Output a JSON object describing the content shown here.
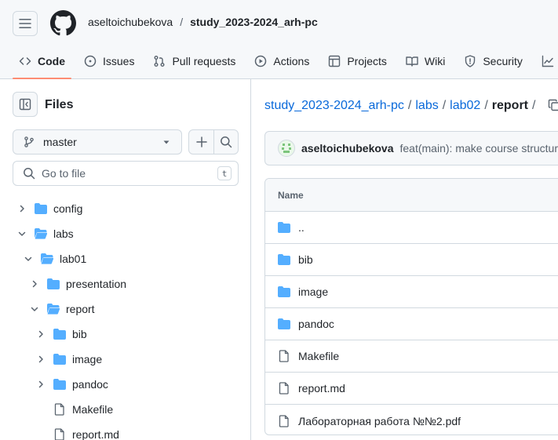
{
  "header": {
    "owner": "aseltoichubekova",
    "separator": "/",
    "repo": "study_2023-2024_arh-pc"
  },
  "tabs": [
    {
      "label": "Code",
      "icon": "code-icon",
      "active": true
    },
    {
      "label": "Issues",
      "icon": "issue-icon",
      "active": false
    },
    {
      "label": "Pull requests",
      "icon": "pull-request-icon",
      "active": false
    },
    {
      "label": "Actions",
      "icon": "play-icon",
      "active": false
    },
    {
      "label": "Projects",
      "icon": "table-icon",
      "active": false
    },
    {
      "label": "Wiki",
      "icon": "book-icon",
      "active": false
    },
    {
      "label": "Security",
      "icon": "shield-icon",
      "active": false
    },
    {
      "label": "",
      "icon": "graph-icon",
      "active": false
    }
  ],
  "sidebar": {
    "title": "Files",
    "branch": "master",
    "goto_placeholder": "Go to file",
    "goto_shortcut": "t",
    "tree": [
      {
        "name": "config",
        "type": "dir",
        "depth": 0,
        "expanded": false
      },
      {
        "name": "labs",
        "type": "dir",
        "depth": 0,
        "expanded": true
      },
      {
        "name": "lab01",
        "type": "dir",
        "depth": 1,
        "expanded": true
      },
      {
        "name": "presentation",
        "type": "dir",
        "depth": 2,
        "expanded": false
      },
      {
        "name": "report",
        "type": "dir",
        "depth": 2,
        "expanded": true
      },
      {
        "name": "bib",
        "type": "dir",
        "depth": 3,
        "expanded": false
      },
      {
        "name": "image",
        "type": "dir",
        "depth": 3,
        "expanded": false
      },
      {
        "name": "pandoc",
        "type": "dir",
        "depth": 3,
        "expanded": false
      },
      {
        "name": "Makefile",
        "type": "file",
        "depth": 3,
        "expanded": false
      },
      {
        "name": "report.md",
        "type": "file",
        "depth": 3,
        "expanded": false
      }
    ]
  },
  "main": {
    "path": {
      "links": [
        "study_2023-2024_arh-pc",
        "labs",
        "lab02"
      ],
      "current": "report",
      "separator": "/"
    },
    "commit": {
      "author": "aseltoichubekova",
      "message": "feat(main): make course structure"
    },
    "table": {
      "header": "Name",
      "rows": [
        {
          "name": "..",
          "type": "dir"
        },
        {
          "name": "bib",
          "type": "dir"
        },
        {
          "name": "image",
          "type": "dir"
        },
        {
          "name": "pandoc",
          "type": "dir"
        },
        {
          "name": "Makefile",
          "type": "file"
        },
        {
          "name": "report.md",
          "type": "file"
        },
        {
          "name": "Лабораторная работа №№2.pdf",
          "type": "file"
        }
      ]
    }
  },
  "colors": {
    "folder": "#54aeff",
    "link": "#0969da",
    "active_tab_underline": "#fd8c73",
    "border": "#d1d9e0",
    "muted_text": "#59636e"
  }
}
